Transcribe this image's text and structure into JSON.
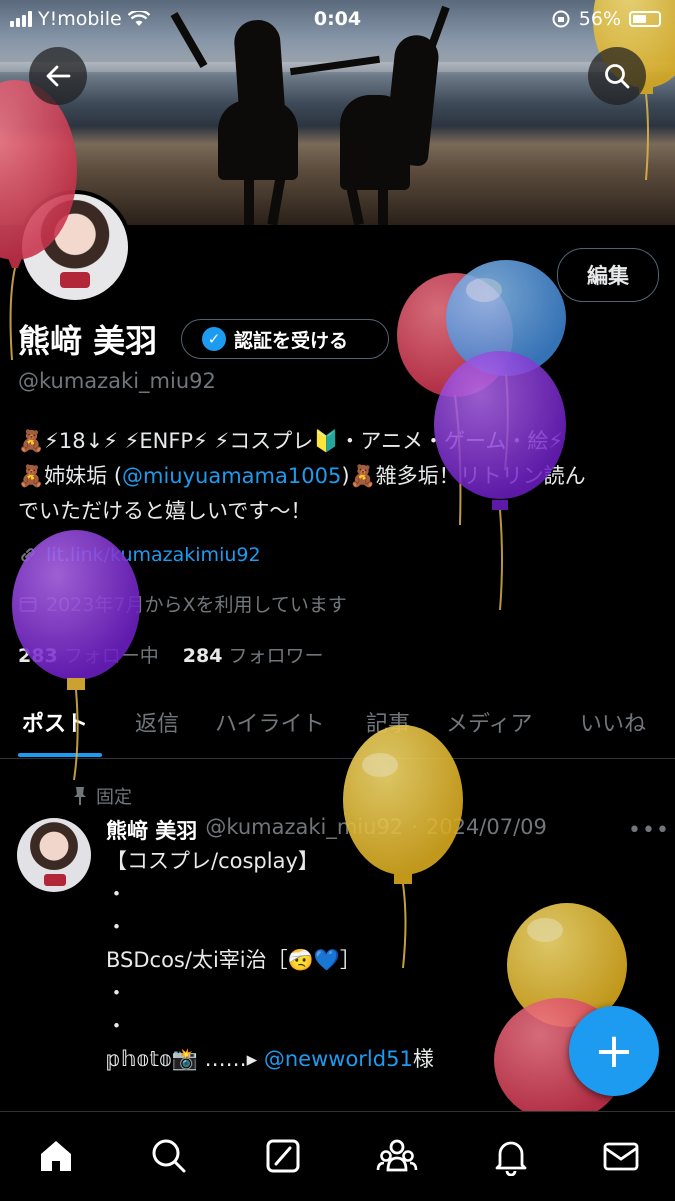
{
  "status_bar": {
    "carrier": "Y!mobile",
    "time": "0:04",
    "battery": "56%"
  },
  "profile": {
    "name": "熊﨑 美羽",
    "handle": "@kumazaki_miu92",
    "edit_label": "編集",
    "verify_label": "認証を受ける",
    "bio_line1": "🧸⚡18↓⚡ ⚡ENFP⚡ ⚡コスプレ🔰・アニメ・ゲーム・絵⚡",
    "bio_line2_pre": "🧸姉妹垢 (",
    "bio_mention": "@miuyuamama1005",
    "bio_line2_post": ")🧸雑多垢！リトリン読ん",
    "bio_line3": "でいただけると嬉しいです〜！",
    "link": "lit.link/kumazakimiu92",
    "joined": "2023年7月からXを利用しています",
    "following_count": "283",
    "following_label": "フォロー中",
    "followers_count": "284",
    "followers_label": "フォロワー"
  },
  "tabs": [
    "ポスト",
    "返信",
    "ハイライト",
    "記事",
    "メディア",
    "いいね"
  ],
  "post": {
    "pinned_label": "固定",
    "author_name": "熊﨑 美羽",
    "author_handle": "@kumazaki_miu92",
    "separator": "·",
    "date": "2024/07/09",
    "more": "•••",
    "line1": "【コスプレ/cosplay】",
    "dot": "・",
    "line_bsd": "BSDcos/太i宰i治［🤕💙］",
    "photo_prefix": "𝕡𝕙𝕠𝕥𝕠📸 ……▸ ",
    "photo_mention": "@newworld51",
    "photo_suffix": "様"
  },
  "fab_label": "+",
  "icons": {
    "back": "back-arrow-icon",
    "search": "search-icon",
    "home": "home-icon",
    "explore": "search-icon",
    "grok": "grok-icon",
    "communities": "communities-icon",
    "notifications": "bell-icon",
    "messages": "mail-icon",
    "verified": "verified-check-icon",
    "pin": "pin-icon",
    "link": "link-icon",
    "calendar": "calendar-icon"
  },
  "colors": {
    "accent": "#1d9bf0",
    "background": "#000000",
    "muted": "#71767b"
  }
}
